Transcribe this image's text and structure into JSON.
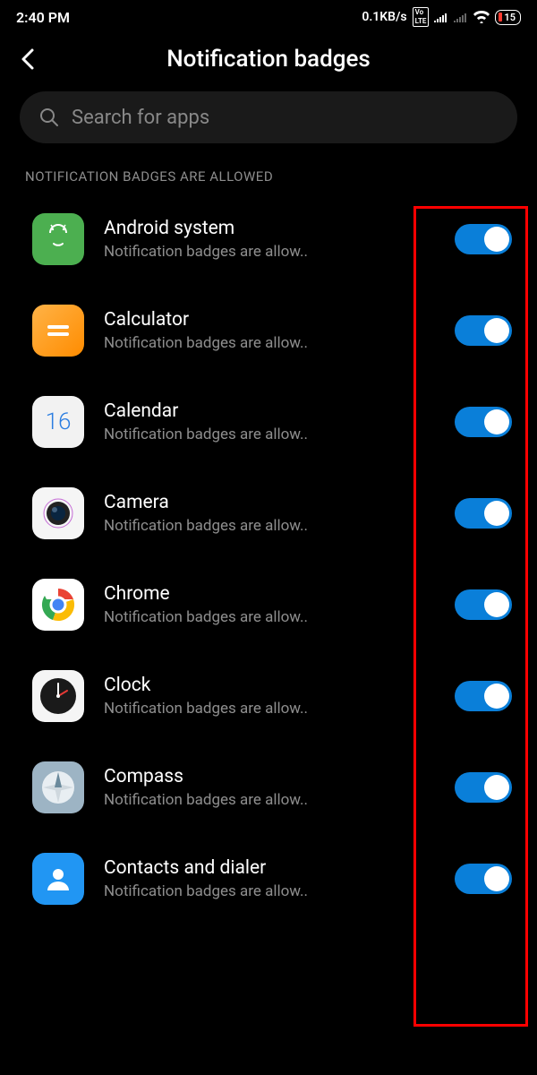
{
  "status": {
    "time": "2:40 PM",
    "net_speed": "0.1KB/s",
    "battery": "15"
  },
  "header": {
    "title": "Notification badges"
  },
  "search": {
    "placeholder": "Search for apps"
  },
  "section": {
    "label": "NOTIFICATION BADGES ARE ALLOWED"
  },
  "apps": [
    {
      "name": "Android system",
      "sub": "Notification badges are allow.."
    },
    {
      "name": "Calculator",
      "sub": "Notification badges are allow.."
    },
    {
      "name": "Calendar",
      "sub": "Notification badges are allow.."
    },
    {
      "name": "Camera",
      "sub": "Notification badges are allow.."
    },
    {
      "name": "Chrome",
      "sub": "Notification badges are allow.."
    },
    {
      "name": "Clock",
      "sub": "Notification badges are allow.."
    },
    {
      "name": "Compass",
      "sub": "Notification badges are allow.."
    },
    {
      "name": "Contacts and dialer",
      "sub": "Notification badges are allow.."
    }
  ],
  "calendar_day": "16"
}
